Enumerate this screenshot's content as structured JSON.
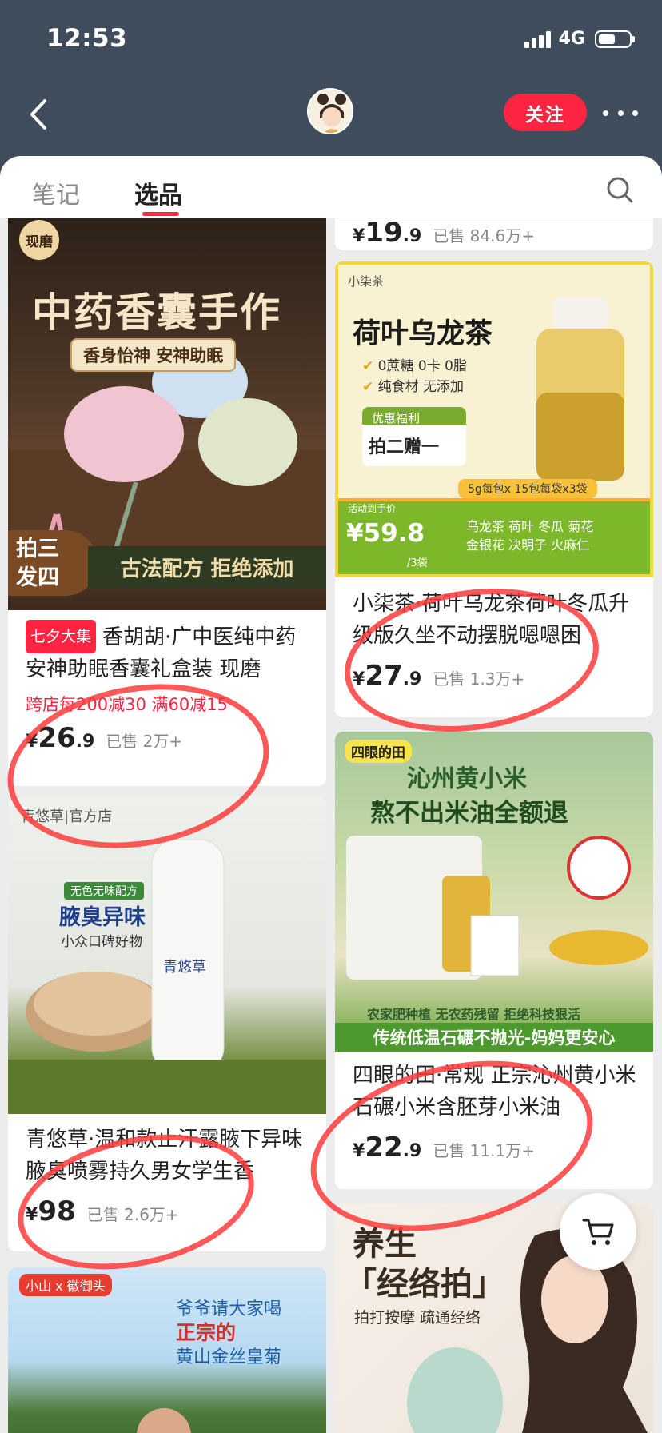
{
  "status": {
    "time": "12:53",
    "network": "4G"
  },
  "header": {
    "follow_label": "关注"
  },
  "tabs": [
    {
      "label": "笔记"
    },
    {
      "label": "选品"
    }
  ],
  "cards": {
    "c1": {
      "badge": "现磨",
      "img_title": "中药香囊手作",
      "img_sub": "香身怡神 安神助眠",
      "img_left": "拍三\n发四",
      "img_bottom": "古法配方  拒绝添加",
      "tag": "七夕大集",
      "title": "香胡胡·广中医纯中药安神助眠香囊礼盒装 现磨",
      "promo": "跨店每200减30  满60减15",
      "price_int": "26",
      "price_dec": ".9",
      "sold": "已售 2万+"
    },
    "c0": {
      "price_int": "19",
      "price_dec": ".9",
      "sold": "已售 84.6万+"
    },
    "c2": {
      "brand": "小柒茶",
      "img_title": "荷叶乌龙茶",
      "check1": "0蔗糖 0卡 0脂",
      "check2": "纯食材 无添加",
      "benefit_label": "优惠福利",
      "benefit": "拍二赠一",
      "spec": "5g每包x 15包每袋x3袋",
      "act_label": "活动到手价",
      "act_price": "¥59.8",
      "act_unit": "/3袋",
      "ingredients": "乌龙茶 荷叶 冬瓜 菊花\n金银花 决明子 火麻仁",
      "title": "小柒茶·荷叶乌龙茶荷叶冬瓜升级版久坐不动摆脱嗯嗯困",
      "price_int": "27",
      "price_dec": ".9",
      "sold": "已售 1.3万+"
    },
    "c3": {
      "brand": "青悠草|官方店",
      "img_tag": "无色无味配方",
      "img_title": "腋臭异味",
      "img_sub": "小众口碑好物",
      "bottle_label": "青悠草",
      "title": "青悠草·温和款止汗露腋下异味腋臭喷雾持久男女学生香",
      "price_int": "98",
      "price_dec": "",
      "sold": "已售 2.6万+"
    },
    "c4": {
      "brand": "四眼的田",
      "img_title": "沁州黄小米",
      "img_sub": "熬不出米油全额退",
      "img_features": "农家肥种植  无农药残留  拒绝科技狠活",
      "img_bottom": "传统低温石碾不抛光-妈妈更安心",
      "title": "四眼的田·常规 正宗沁州黄小米石碾小米含胚芽小米油",
      "price_int": "22",
      "price_dec": ".9",
      "sold": "已售 11.1万+"
    },
    "c5": {
      "brand1": "小山",
      "brand2": "x 徽御头",
      "img_line1": "爷爷请大家喝",
      "img_line2": "正宗的",
      "img_line3": "黄山金丝皇菊"
    },
    "c6": {
      "img_title1": "养生",
      "img_title2": "「经络拍」",
      "img_sub": "拍打按摩  疏通经络"
    }
  },
  "colors": {
    "accent": "#ff2442",
    "header_bg": "#3f4c5c"
  }
}
